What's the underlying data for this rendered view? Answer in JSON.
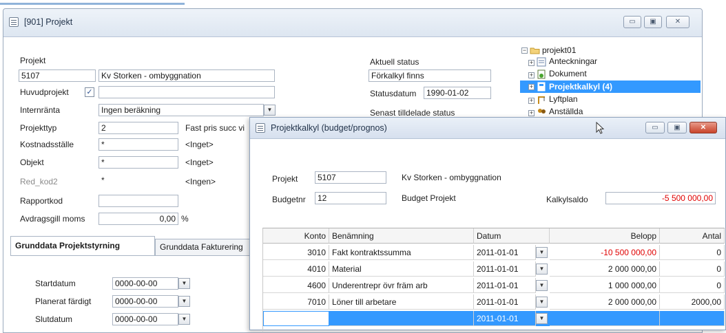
{
  "main_window": {
    "title": "[901] Projekt",
    "fields": {
      "projekt_label": "Projekt",
      "projekt_nr": "5107",
      "projekt_name": "Kv Storken - ombyggnation",
      "huvudprojekt_label": "Huvudprojekt",
      "huvudprojekt_checked": "✓",
      "huvudprojekt_value": "",
      "internranta_label": "Internränta",
      "internranta_value": "Ingen beräkning",
      "projekttyp_label": "Projekttyp",
      "projekttyp_value": "2",
      "projekttyp_desc": "Fast pris succ vi",
      "kostnadsstalle_label": "Kostnadsställe",
      "kostnadsstalle_value": "*",
      "kostnadsstalle_desc": "<Inget>",
      "objekt_label": "Objekt",
      "objekt_value": "*",
      "objekt_desc": "<Inget>",
      "red_kod2_label": "Red_kod2",
      "red_kod2_value": "*",
      "red_kod2_desc": "<Ingen>",
      "rapportkod_label": "Rapportkod",
      "rapportkod_value": "",
      "avdragsgill_label": "Avdragsgill moms",
      "avdragsgill_value": "0,00",
      "avdragsgill_unit": "%"
    },
    "status": {
      "aktuell_label": "Aktuell status",
      "aktuell_value": "Förkalkyl finns",
      "statusdatum_label": "Statusdatum",
      "statusdatum_value": "1990-01-02",
      "senast_label": "Senast tilldelade status"
    },
    "tabs": [
      {
        "label": "Grunddata Projektstyrning"
      },
      {
        "label": "Grunddata Fakturering"
      }
    ],
    "dates": {
      "startdatum_label": "Startdatum",
      "startdatum_value": "0000-00-00",
      "planerat_label": "Planerat färdigt",
      "planerat_value": "0000-00-00",
      "slutdatum_label": "Slutdatum",
      "slutdatum_value": "0000-00-00"
    },
    "tree": {
      "root": "projekt01",
      "items": [
        {
          "label": "Anteckningar"
        },
        {
          "label": "Dokument"
        },
        {
          "label": "Projektkalkyl (4)"
        },
        {
          "label": "Lyftplan"
        },
        {
          "label": "Anställda"
        }
      ]
    },
    "window_buttons": {
      "minimize": "▭",
      "maximize": "▣",
      "close": "✕"
    }
  },
  "child_window": {
    "title": "Projektkalkyl (budget/prognos)",
    "projekt_label": "Projekt",
    "projekt_nr": "5107",
    "projekt_name": "Kv Storken - ombyggnation",
    "budgetnr_label": "Budgetnr",
    "budgetnr_value": "12",
    "budget_name": "Budget Projekt",
    "kalkylsaldo_label": "Kalkylsaldo",
    "kalkylsaldo_value": "-5 500 000,00",
    "window_buttons": {
      "minimize": "▭",
      "maximize": "▣",
      "close": "✕"
    },
    "grid": {
      "headers": [
        "Konto",
        "Benämning",
        "Datum",
        "Belopp",
        "Antal"
      ],
      "rows": [
        {
          "konto": "3010",
          "benamning": "Fakt kontraktssumma",
          "datum": "2011-01-01",
          "belopp": "-10 500 000,00",
          "antal": "0"
        },
        {
          "konto": "4010",
          "benamning": "Material",
          "datum": "2011-01-01",
          "belopp": "2 000 000,00",
          "antal": "0"
        },
        {
          "konto": "4600",
          "benamning": "Underentrepr övr främ arb",
          "datum": "2011-01-01",
          "belopp": "1 000 000,00",
          "antal": "0"
        },
        {
          "konto": "7010",
          "benamning": "Löner till arbetare",
          "datum": "2011-01-01",
          "belopp": "2 000 000,00",
          "antal": "2000,00"
        },
        {
          "konto": "",
          "benamning": "",
          "datum": "2011-01-01",
          "belopp": "",
          "antal": ""
        }
      ]
    }
  },
  "colors": {
    "selection": "#3399ff",
    "negative": "#e00000",
    "close_button": "#c9432a"
  }
}
